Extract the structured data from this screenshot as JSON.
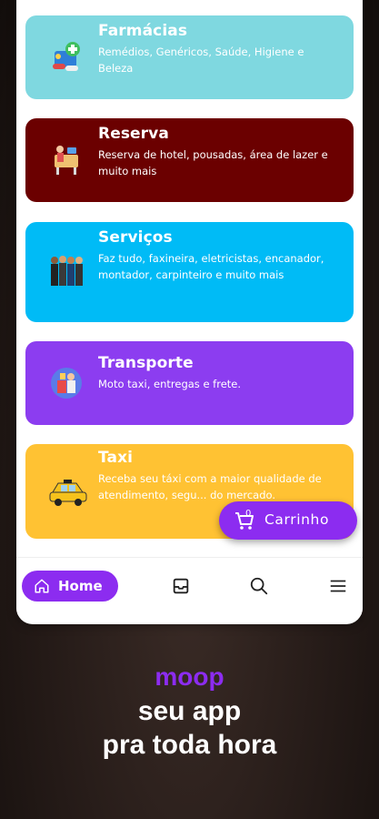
{
  "categories": [
    {
      "title": "Farmácias",
      "description": "Remédios, Genéricos, Saúde, Higiene e Beleza",
      "color": "#7fd8e0",
      "icon": "pharmacy-icon"
    },
    {
      "title": "Reserva",
      "description": "Reserva de hotel, pousadas, área de lazer e muito mais",
      "color": "#6b0000",
      "icon": "reservation-icon"
    },
    {
      "title": "Serviços",
      "description": "Faz tudo, faxineira, eletricistas, encanador, montador, carpinteiro e muito mais",
      "color": "#00bbf6",
      "icon": "workers-icon"
    },
    {
      "title": "Transporte",
      "description": "Moto taxi, entregas e frete.",
      "color": "#8c3df0",
      "icon": "delivery-icon"
    },
    {
      "title": "Taxi",
      "description": "Receba seu táxi com a maior qualidade de atendimento, segu... do mercado.",
      "color": "#ffc233",
      "icon": "taxi-icon"
    }
  ],
  "cart": {
    "label": "Carrinho",
    "count": "0",
    "icon": "cart-icon"
  },
  "nav": {
    "home_label": "Home",
    "icons": [
      "home-icon",
      "inbox-icon",
      "search-icon",
      "menu-icon"
    ]
  },
  "footer": {
    "brand": "moop",
    "tagline_1": "seu app",
    "tagline_2": "pra toda hora"
  },
  "colors": {
    "accent": "#8c2cf0",
    "background": "#241a17"
  }
}
